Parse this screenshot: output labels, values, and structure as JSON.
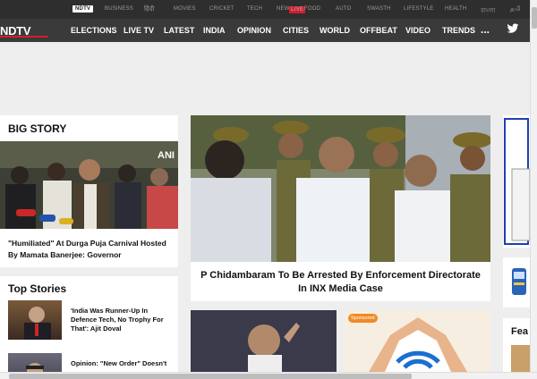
{
  "subnav": {
    "items": [
      {
        "label": "NDTV",
        "active": true
      },
      {
        "label": "BUSINESS"
      },
      {
        "label": "हिंदी"
      },
      {
        "label": "MOVIES"
      },
      {
        "label": "CRICKET"
      },
      {
        "label": "TECH"
      },
      {
        "label": "NEW"
      },
      {
        "label": "FOOD"
      },
      {
        "label": "AUTO"
      },
      {
        "label": "SWASTH"
      },
      {
        "label": "LIFESTYLE"
      },
      {
        "label": "HEALTH"
      },
      {
        "label": "বাংলা"
      },
      {
        "label": "தமி"
      }
    ],
    "live_badge": "LIVE"
  },
  "mainnav": {
    "logo": "NDTV",
    "items": [
      "ELECTIONS",
      "LIVE TV",
      "LATEST",
      "INDIA",
      "OPINION",
      "CITIES",
      "WORLD",
      "OFFBEAT",
      "VIDEO",
      "TRENDS"
    ],
    "more": "...",
    "twitter_icon": "twitter-icon"
  },
  "big_story": {
    "title": "BIG STORY",
    "image_watermark": "ANI",
    "caption": "\"Humiliated\" At Durga Puja Carnival Hosted By Mamata Banerjee: Governor"
  },
  "top_stories": {
    "title": "Top Stories",
    "items": [
      {
        "text": "'India Was Runner-Up In Defence Tech, No Trophy For That': Ajit Doval"
      },
      {
        "text": "Opinion: \"New Order\" Doesn't"
      }
    ]
  },
  "hero": {
    "caption": "P Chidambaram To Be Arrested By Enforcement Directorate In INX Media Case"
  },
  "promo": {
    "sponsored_label": "Sponsored"
  },
  "right_column": {
    "section_partial": "Fea"
  },
  "colors": {
    "topbar": "#3a3a3a",
    "accent": "#d81b2b",
    "sponsored": "#f08a24"
  }
}
